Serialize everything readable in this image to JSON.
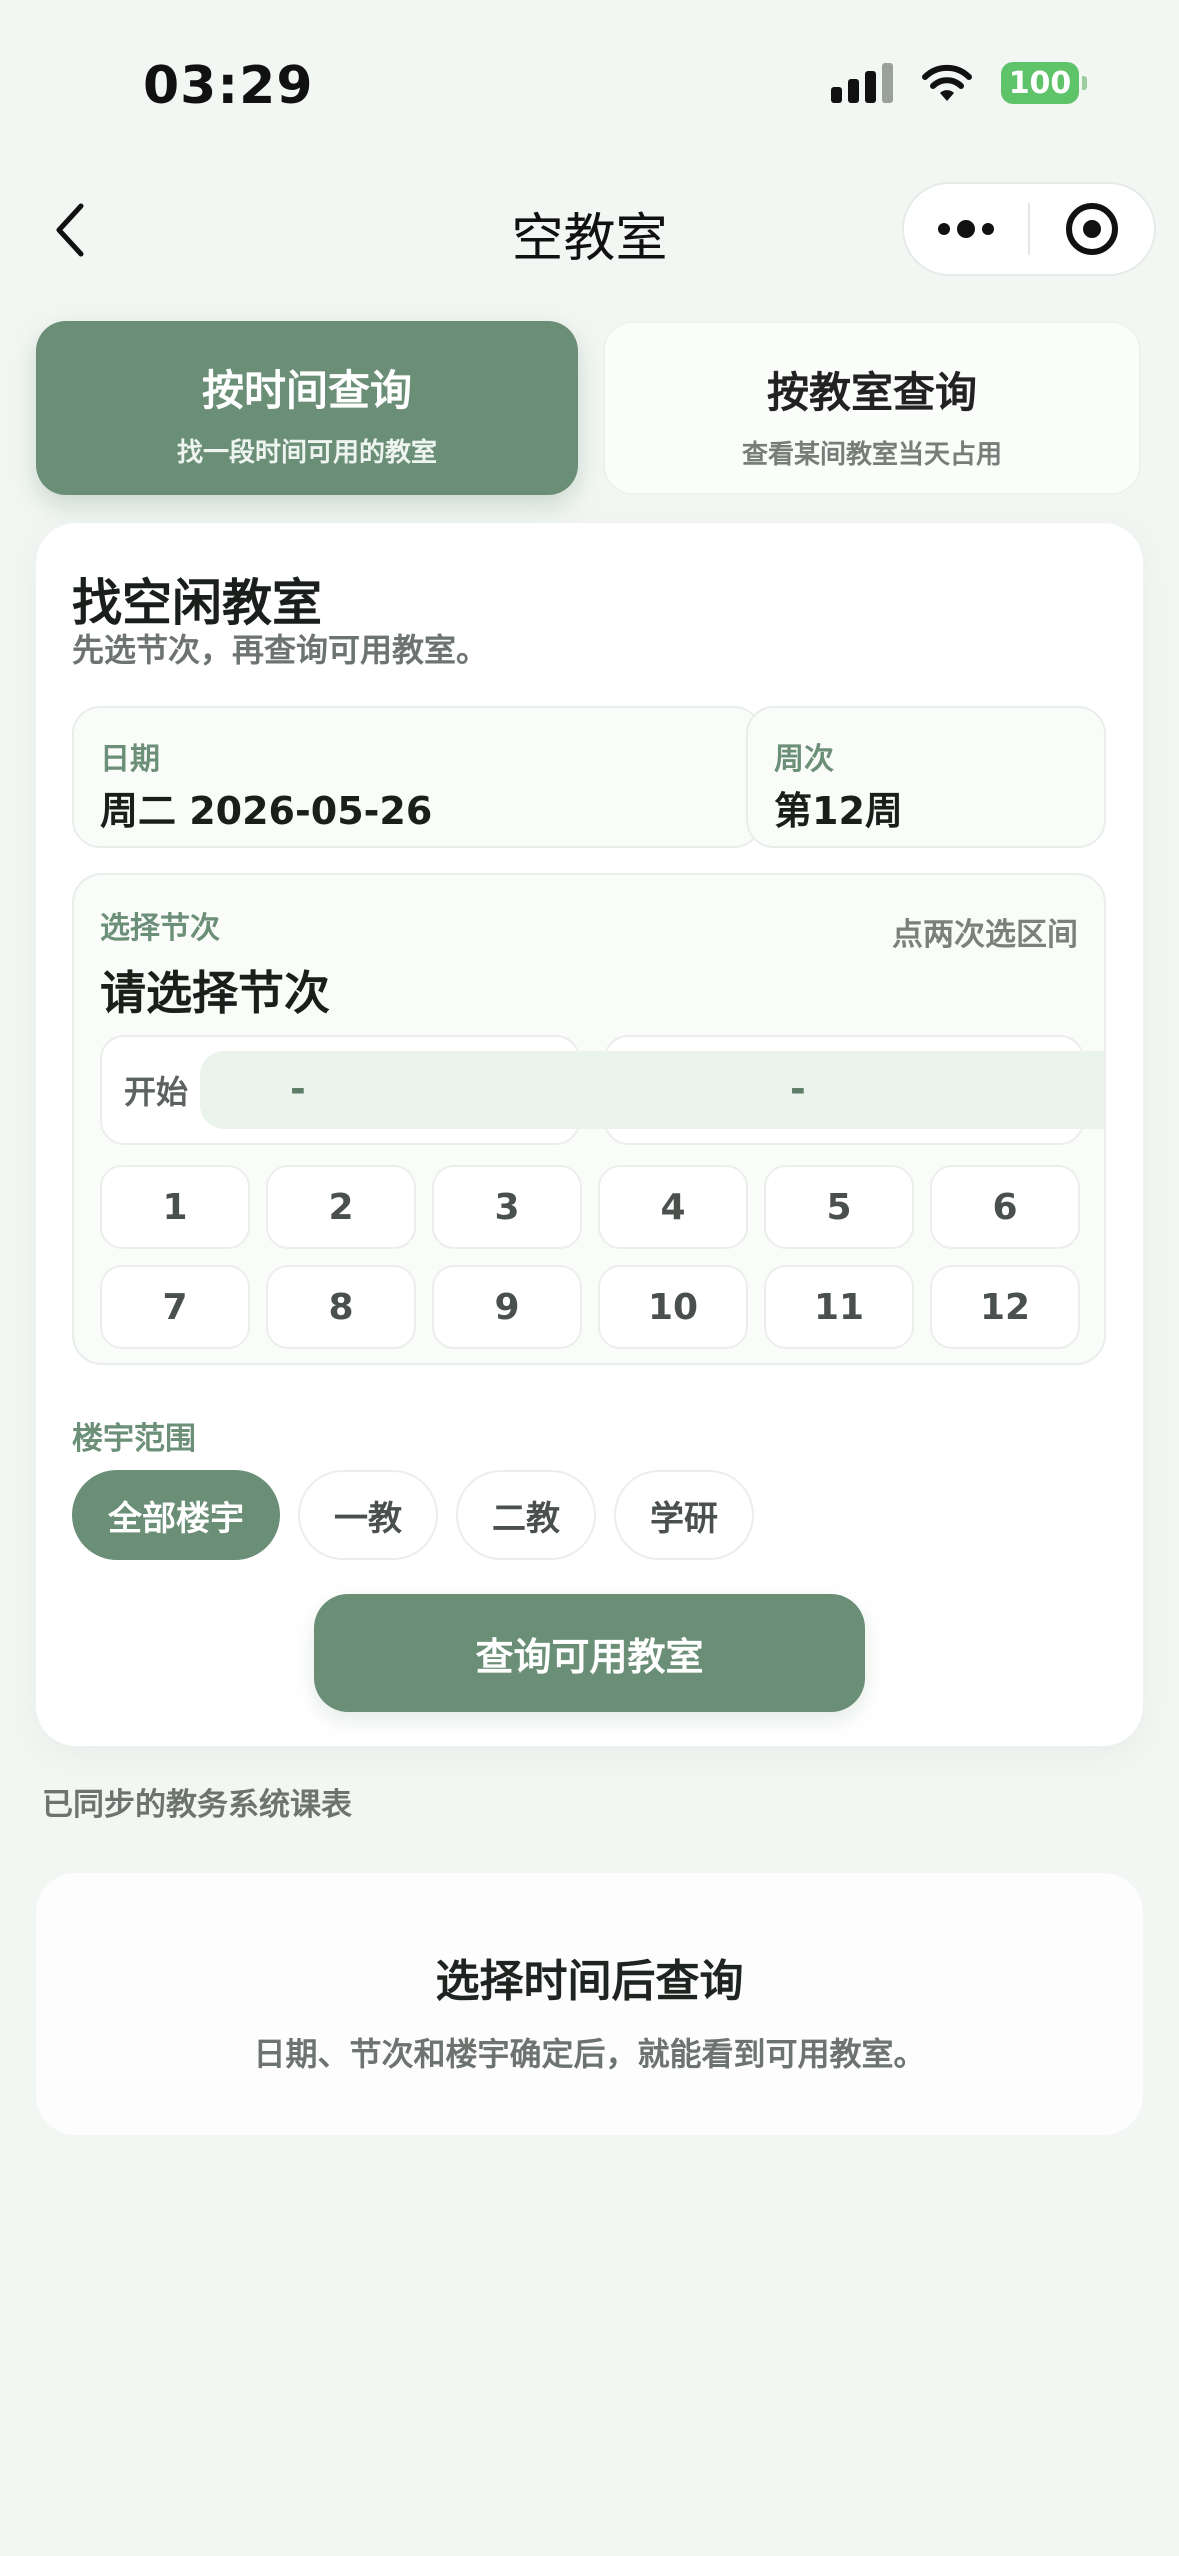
{
  "status_bar": {
    "time": "03:29",
    "battery": "100"
  },
  "nav": {
    "title": "空教室"
  },
  "mode_tabs": [
    {
      "title": "按时间查询",
      "subtitle": "找一段时间可用的教室"
    },
    {
      "title": "按教室查询",
      "subtitle": "查看某间教室当天占用"
    }
  ],
  "finder": {
    "title": "找空闲教室",
    "subtitle": "先选节次，再查询可用教室。",
    "date": {
      "label": "日期",
      "value": "周二 2026-05-26"
    },
    "week": {
      "label": "周次",
      "value": "第12周"
    },
    "period": {
      "label": "选择节次",
      "hint": "点两次选区间",
      "title": "请选择节次",
      "start_label": "开始",
      "start_value": "-",
      "end_value": "-",
      "options": [
        "1",
        "2",
        "3",
        "4",
        "5",
        "6",
        "7",
        "8",
        "9",
        "10",
        "11",
        "12"
      ]
    },
    "building": {
      "label": "楼宇范围",
      "options": [
        "全部楼宇",
        "一教",
        "二教",
        "学研"
      ],
      "selected": "全部楼宇"
    },
    "query_button": "查询可用教室"
  },
  "sync_note": "已同步的教务系统课表",
  "empty_state": {
    "title": "选择时间后查询",
    "subtitle": "日期、节次和楼宇确定后，就能看到可用教室。"
  },
  "colors": {
    "accent": "#6a8e76",
    "label": "#6c8f78",
    "background": "#f3f7f4",
    "range_fill": "#eaf3ec"
  },
  "icons": {
    "back": "chevron-left-icon",
    "more": "more-dots-icon",
    "close": "target-circle-icon"
  }
}
